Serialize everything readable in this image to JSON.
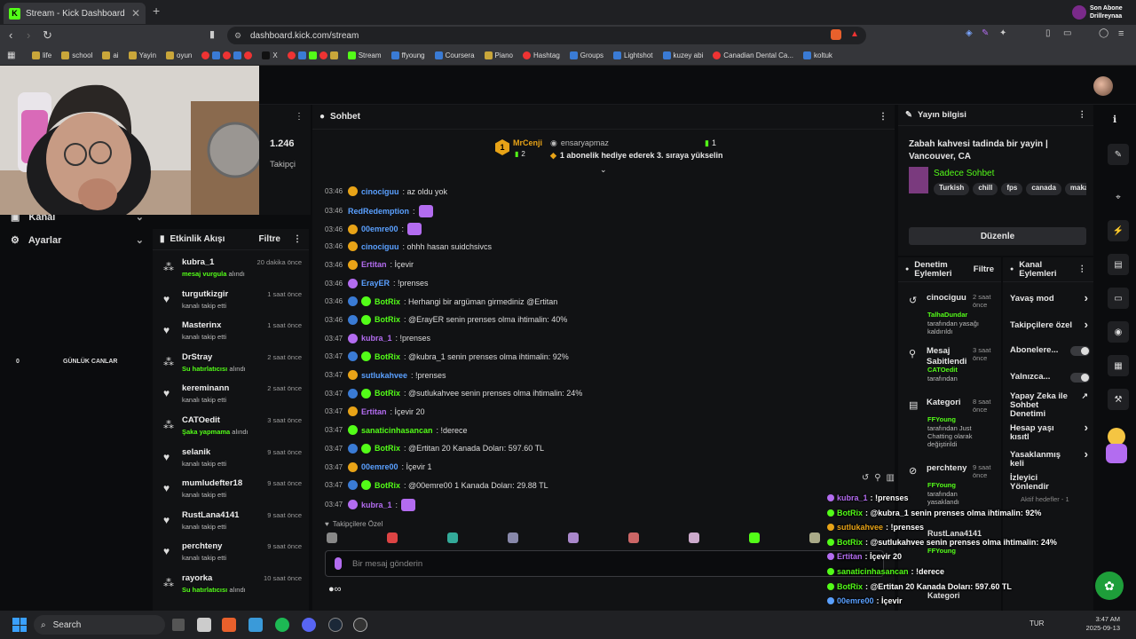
{
  "browser": {
    "tab_title": "Stream - Kick Dashboard",
    "url": "dashboard.kick.com/stream",
    "notification": {
      "line1": "Son Abone",
      "line2": "Drillreynaa"
    },
    "bookmarks": [
      "life",
      "school",
      "ai",
      "Yayin",
      "oyun",
      "X",
      "Stream",
      "ffyoung",
      "Coursera",
      "Piano",
      "Hashtag",
      "Groups",
      "Lightshot",
      "kuzey abi",
      "Canadian Dental Ca...",
      "koltuk"
    ]
  },
  "left_nav": {
    "kanal": "Kanal",
    "ayarlar": "Ayarlar",
    "daily_value": "0",
    "daily_label": "GÜNLÜK CANLAR"
  },
  "stats": {
    "followers": "1.246",
    "followers_label": "Takipçi"
  },
  "feed": {
    "title": "Etkinlik Akışı",
    "filter": "Filtre",
    "items": [
      {
        "name": "kubra_1",
        "desc": "mesaj vurgula",
        "suffix": "alındı",
        "time": "20 dakika önce"
      },
      {
        "name": "turgutkizgir",
        "desc": "",
        "suffix": "kanalı takip etti",
        "time": "1 saat önce"
      },
      {
        "name": "Masterinx",
        "desc": "",
        "suffix": "kanalı takip etti",
        "time": "1 saat önce"
      },
      {
        "name": "DrStray",
        "desc": "Su hatırlatıcısı",
        "suffix": "alındı",
        "time": "2 saat önce"
      },
      {
        "name": "kereminann",
        "desc": "",
        "suffix": "kanalı takip etti",
        "time": "2 saat önce"
      },
      {
        "name": "CATOedit",
        "desc": "Şaka yapmama",
        "suffix": "alındı",
        "time": "3 saat önce"
      },
      {
        "name": "selanik",
        "desc": "",
        "suffix": "kanalı takip etti",
        "time": "9 saat önce"
      },
      {
        "name": "mumludefter18",
        "desc": "",
        "suffix": "kanalı takip etti",
        "time": "9 saat önce"
      },
      {
        "name": "RustLana4141",
        "desc": "",
        "suffix": "kanalı takip etti",
        "time": "9 saat önce"
      },
      {
        "name": "perchteny",
        "desc": "",
        "suffix": "kanalı takip etti",
        "time": "9 saat önce"
      },
      {
        "name": "rayorka",
        "desc": "Su hatırlatıcısı",
        "suffix": "alındı",
        "time": "10 saat önce"
      }
    ]
  },
  "chat": {
    "title": "Sohbet",
    "pinned": {
      "rank": "1",
      "gifter": "MrCenji",
      "gift_count": "2",
      "user": "ensaryapmaz",
      "sub_count": "1",
      "text": "1 abonelik hediye ederek 3. sıraya yükselin"
    },
    "messages": [
      {
        "t": "03:46",
        "u": "cinociguu",
        "c": "#5aa0ff",
        "b": "#e8a317",
        "m": ": az oldu yok"
      },
      {
        "t": "03:46",
        "u": "RedRedemption",
        "c": "#5aa0ff",
        "b": "",
        "m": ":"
      },
      {
        "t": "03:46",
        "u": "00emre00",
        "c": "#5aa0ff",
        "b": "#e8a317",
        "m": ":"
      },
      {
        "t": "03:46",
        "u": "cinociguu",
        "c": "#5aa0ff",
        "b": "#e8a317",
        "m": ": ohhh hasan suidchsivcs"
      },
      {
        "t": "03:46",
        "u": "Ertitan",
        "c": "#b36cf0",
        "b": "#e8a317",
        "m": ": İçevir"
      },
      {
        "t": "03:46",
        "u": "ErayER",
        "c": "#5aa0ff",
        "b": "#b36cf0",
        "m": ": !prenses"
      },
      {
        "t": "03:46",
        "u": "BotRix",
        "c": "#53fc18",
        "b": "#53fc18",
        "m": ": Herhangi bir argüman girmediniz @Ertitan"
      },
      {
        "t": "03:46",
        "u": "BotRix",
        "c": "#53fc18",
        "b": "#53fc18",
        "m": ": @ErayER senin prenses olma ihtimalin: 40%"
      },
      {
        "t": "03:47",
        "u": "kubra_1",
        "c": "#b36cf0",
        "b": "#b36cf0",
        "m": ": !prenses"
      },
      {
        "t": "03:47",
        "u": "BotRix",
        "c": "#53fc18",
        "b": "#53fc18",
        "m": ": @kubra_1 senin prenses olma ihtimalin: 92%"
      },
      {
        "t": "03:47",
        "u": "sutlukahvee",
        "c": "#5aa0ff",
        "b": "#e8a317",
        "m": ": !prenses"
      },
      {
        "t": "03:47",
        "u": "BotRix",
        "c": "#53fc18",
        "b": "#53fc18",
        "m": ": @sutlukahvee senin prenses olma ihtimalin: 24%"
      },
      {
        "t": "03:47",
        "u": "Ertitan",
        "c": "#b36cf0",
        "b": "#e8a317",
        "m": ": İçevir 20"
      },
      {
        "t": "03:47",
        "u": "sanaticinhasancan",
        "c": "#53fc18",
        "b": "#53fc18",
        "m": ": !derece"
      },
      {
        "t": "03:47",
        "u": "BotRix",
        "c": "#53fc18",
        "b": "#53fc18",
        "m": ": @Ertitan 20 Kanada Doları: 597.60 TL"
      },
      {
        "t": "03:47",
        "u": "00emre00",
        "c": "#5aa0ff",
        "b": "#e8a317",
        "m": ": İçevir 1"
      },
      {
        "t": "03:47",
        "u": "BotRix",
        "c": "#53fc18",
        "b": "#53fc18",
        "m": ": @00emre00 1 Kanada Doları: 29.88 TL"
      },
      {
        "t": "03:47",
        "u": "kubra_1",
        "c": "#b36cf0",
        "b": "#b36cf0",
        "m": ":"
      }
    ],
    "followers_only": "Takipçilere Özel",
    "input_placeholder": "Bir mesaj gönderin"
  },
  "info": {
    "title": "Yayın bilgisi",
    "stream_title": "Zabah kahvesi tadinda bir yayin | Vancouver, CA",
    "category": "Sadece Sohbet",
    "tags": [
      "Turkish",
      "chill",
      "fps",
      "canada",
      "maka"
    ],
    "edit": "Düzenle"
  },
  "mod": {
    "title": "Denetim Eylemleri",
    "filter": "Filtre",
    "items": [
      {
        "name": "cinociguu",
        "time": "2 saat önce",
        "by": "TalhaDundar",
        "desc": "tarafından yasağı kaldırıldı"
      },
      {
        "name": "Mesaj Sabitlendi",
        "time": "3 saat önce",
        "by": "CATOedit",
        "desc": "tarafından"
      },
      {
        "name": "Kategori",
        "time": "8 saat önce",
        "by": "FFYoung",
        "desc": "tarafından Just Chatting olarak değiştirildi"
      },
      {
        "name": "perchteny",
        "time": "9 saat önce",
        "by": "FFYoung",
        "desc": "tarafından yasaklandı"
      }
    ],
    "extra": [
      "RustLana4141",
      "FFYoung",
      "Kategori"
    ]
  },
  "channel": {
    "title": "Kanal Eylemleri",
    "items": [
      "Yavaş mod",
      "Takipçilere özel",
      "Abonelere...",
      "Yalnızca...",
      "Yapay Zeka ile Sohbet Denetimi",
      "Hesap yaşı kısıtl",
      "Yasaklanmış keli",
      "İzleyici Yönlendir"
    ],
    "active_goals": "Aktif hedefler - 1"
  },
  "overlay": [
    {
      "u": "kubra_1",
      "c": "#b36cf0",
      "m": ": !prenses"
    },
    {
      "u": "BotRix",
      "c": "#53fc18",
      "m": ": @kubra_1 senin prenses olma ihtimalin: 92%"
    },
    {
      "u": "sutlukahvee",
      "c": "#e8a317",
      "m": ": !prenses"
    },
    {
      "u": "BotRix",
      "c": "#53fc18",
      "m": ": @sutlukahvee senin prenses olma ihtimalin: 24%"
    },
    {
      "u": "Ertitan",
      "c": "#b36cf0",
      "m": ": İçevir 20"
    },
    {
      "u": "sanaticinhasancan",
      "c": "#53fc18",
      "m": ": !derece"
    },
    {
      "u": "BotRix",
      "c": "#53fc18",
      "m": ": @Ertitan 20 Kanada Doları: 597.60 TL"
    },
    {
      "u": "00emre00",
      "c": "#5aa0ff",
      "m": ": İçevir"
    },
    {
      "u": "BotRix",
      "c": "#53fc18",
      "m": ": @00emre00 1 Kanada Doları: 29.88 TL"
    },
    {
      "u": "kubra_1",
      "c": "#b36cf0",
      "m": ":"
    }
  ],
  "taskbar": {
    "search": "Search",
    "lang": "TUR",
    "time": "3:47 AM",
    "date": "2025-09-13"
  }
}
